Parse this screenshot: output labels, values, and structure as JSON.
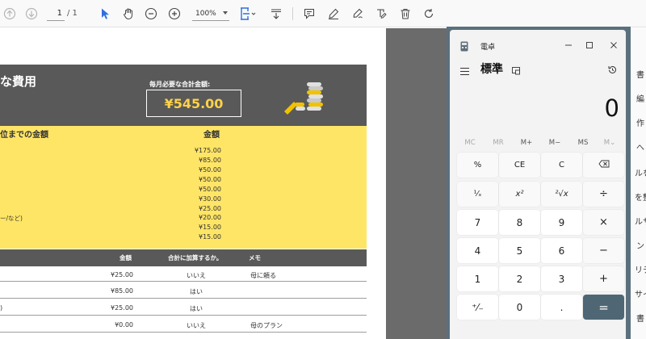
{
  "toolbar": {
    "page_current": "1",
    "page_separator": "/ 1",
    "zoom": "100%"
  },
  "sheet": {
    "title": "な費用",
    "total_label": "毎月必要な合計金額:",
    "total_value": "¥545.00",
    "section_left_header": "位までの金額",
    "section_right_header": "金額",
    "amounts": [
      "¥175.00",
      "¥85.00",
      "¥50.00",
      "¥50.00",
      "¥50.00",
      "¥30.00",
      "¥25.00",
      "¥20.00",
      "¥15.00",
      "¥15.00"
    ],
    "partial_note": "ー/など)",
    "table_headers": {
      "amount": "金額",
      "add_to_total": "合計に加算するか。",
      "memo": "メモ"
    },
    "rows": [
      {
        "prefix": "",
        "amount": "¥25.00",
        "add": "いいえ",
        "memo": "母に頼る"
      },
      {
        "prefix": "",
        "amount": "¥85.00",
        "add": "はい",
        "memo": ""
      },
      {
        "prefix": ")",
        "amount": "¥25.00",
        "add": "はい",
        "memo": ""
      },
      {
        "prefix": "",
        "amount": "¥0.00",
        "add": "いいえ",
        "memo": "母のプラン"
      }
    ]
  },
  "side_panel": {
    "lines": [
      "書",
      "編",
      "作",
      "へ",
      "ルを",
      "を整",
      "ルサ",
      "ン",
      "リテ",
      "サイ",
      "書"
    ]
  },
  "calculator": {
    "title": "電卓",
    "mode": "標準",
    "display": "0",
    "memory_buttons": [
      {
        "label": "MC",
        "enabled": false
      },
      {
        "label": "MR",
        "enabled": false
      },
      {
        "label": "M+",
        "enabled": true
      },
      {
        "label": "M−",
        "enabled": true
      },
      {
        "label": "MS",
        "enabled": true
      },
      {
        "label": "M⌄",
        "enabled": false
      }
    ],
    "keys": [
      [
        "%",
        "CE",
        "C",
        "⌫"
      ],
      [
        "¹⁄ₓ",
        "x²",
        "²√x",
        "÷"
      ],
      [
        "7",
        "8",
        "9",
        "×"
      ],
      [
        "4",
        "5",
        "6",
        "−"
      ],
      [
        "1",
        "2",
        "3",
        "+"
      ],
      [
        "⁺⁄₋",
        "0",
        ".",
        "="
      ]
    ]
  },
  "colors": {
    "dark_band": "#595959",
    "yellow_band": "#ffe566",
    "total_text": "#ffd24a",
    "calc_accent": "#4f6675",
    "calc_frame": "#5b707d"
  }
}
